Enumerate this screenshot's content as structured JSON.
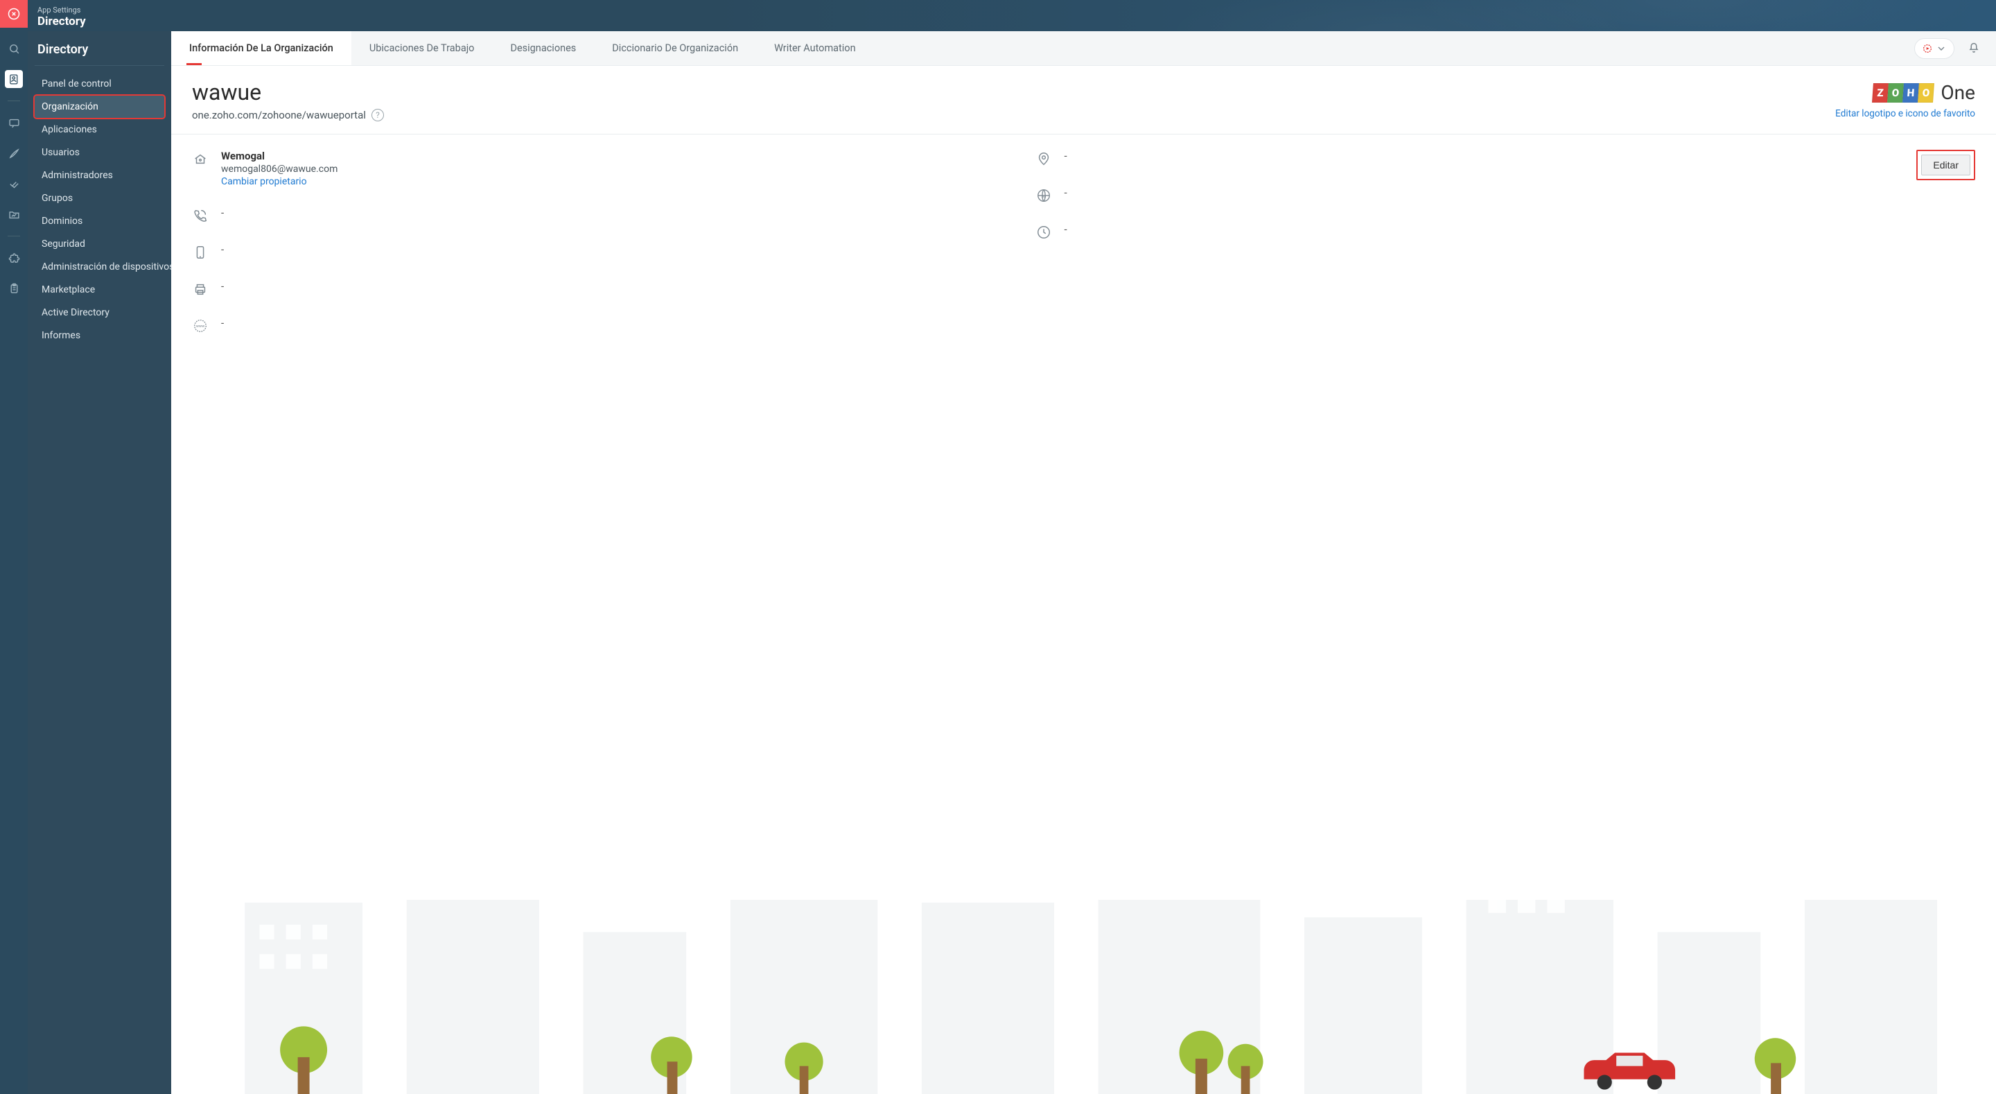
{
  "header": {
    "app_label": "App Settings",
    "app_title": "Directory"
  },
  "sidebar": {
    "heading": "Directory",
    "items": [
      {
        "label": "Panel de control"
      },
      {
        "label": "Organización"
      },
      {
        "label": "Aplicaciones"
      },
      {
        "label": "Usuarios"
      },
      {
        "label": "Administradores"
      },
      {
        "label": "Grupos"
      },
      {
        "label": "Dominios"
      },
      {
        "label": "Seguridad"
      },
      {
        "label": "Administración de dispositivos"
      },
      {
        "label": "Marketplace"
      },
      {
        "label": "Active Directory"
      },
      {
        "label": "Informes"
      }
    ],
    "active_index": 1
  },
  "tabs": {
    "items": [
      {
        "label": "Información De La Organización"
      },
      {
        "label": "Ubicaciones De Trabajo"
      },
      {
        "label": "Designaciones"
      },
      {
        "label": "Diccionario De Organización"
      },
      {
        "label": "Writer Automation"
      }
    ],
    "active_index": 0
  },
  "org": {
    "name": "wawue",
    "url": "one.zoho.com/zohoone/wawueportal",
    "logo_suffix": "One",
    "edit_logo_label": "Editar logotipo e icono de favorito"
  },
  "details": {
    "owner": {
      "name": "Wemogal",
      "email": "wemogal806@wawue.com",
      "change_owner_label": "Cambiar propietario"
    },
    "phone": "-",
    "mobile": "-",
    "fax": "-",
    "website": "-",
    "address": "-",
    "language": "-",
    "timezone": "-",
    "edit_label": "Editar"
  }
}
